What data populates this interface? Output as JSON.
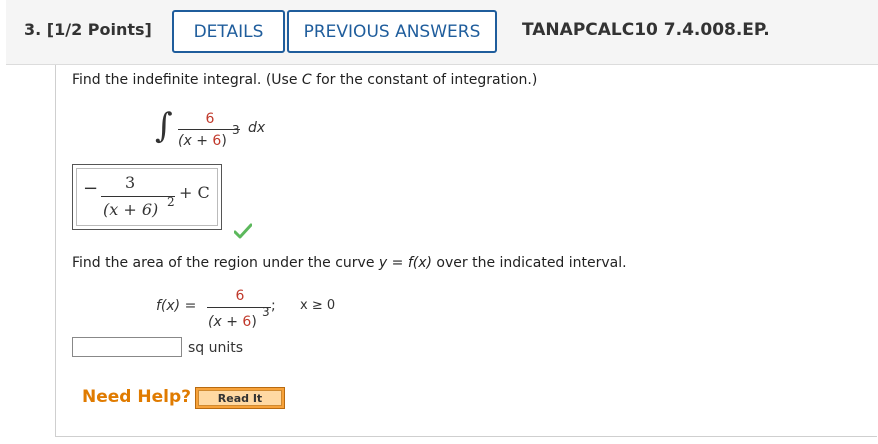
{
  "header": {
    "question_number": "3.",
    "points": "[1/2 Points]",
    "details_label": "DETAILS",
    "previous_answers_label": "PREVIOUS ANSWERS",
    "problem_code": "TANAPCALC10 7.4.008.EP."
  },
  "part1": {
    "prompt_a": "Find the indefinite integral. (Use ",
    "prompt_var": "C",
    "prompt_b": " for the constant of integration.)",
    "integral_sign": "∫",
    "numerator": "6",
    "denom_open": "(x + ",
    "denom_num": "6",
    "denom_close": ")",
    "exponent": "3",
    "differential": "dx",
    "answer": {
      "sign": "−",
      "numerator": "3",
      "denominator": "(x + 6)",
      "exponent": "2",
      "constant": "+ C"
    },
    "status": "correct"
  },
  "part2": {
    "prompt_a": "Find the area of the region under the curve ",
    "prompt_y": "y",
    "prompt_eq": " = ",
    "prompt_fx": "f(x)",
    "prompt_b": " over the indicated interval.",
    "function_label": "f(x) =",
    "numerator": "6",
    "denom_open": "(x + ",
    "denom_num": "6",
    "denom_close": ")",
    "exponent": "3",
    "separator": ";",
    "interval": "x ≥ 0",
    "input_value": "",
    "units": "sq units"
  },
  "help": {
    "label": "Need Help?",
    "read_it_label": "Read It"
  },
  "colors": {
    "link_blue": "#1f5d9c",
    "help_orange": "#e07b00",
    "check_green": "#5cb85c",
    "red_number": "#c0392b"
  }
}
